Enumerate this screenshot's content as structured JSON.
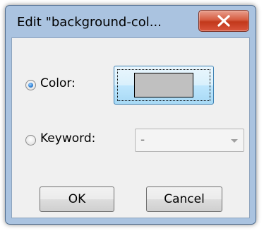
{
  "window": {
    "title": "Edit \"background-col...",
    "close_symbol": "×"
  },
  "color_option": {
    "label": "Color:",
    "selected": true,
    "swatch_color": "#c0c0c0"
  },
  "keyword_option": {
    "label": "Keyword:",
    "selected": false,
    "select_value": "-"
  },
  "buttons": {
    "ok_label": "OK",
    "cancel_label": "Cancel"
  },
  "icons": {
    "close": "close-icon",
    "dropdown": "chevron-down-icon"
  }
}
